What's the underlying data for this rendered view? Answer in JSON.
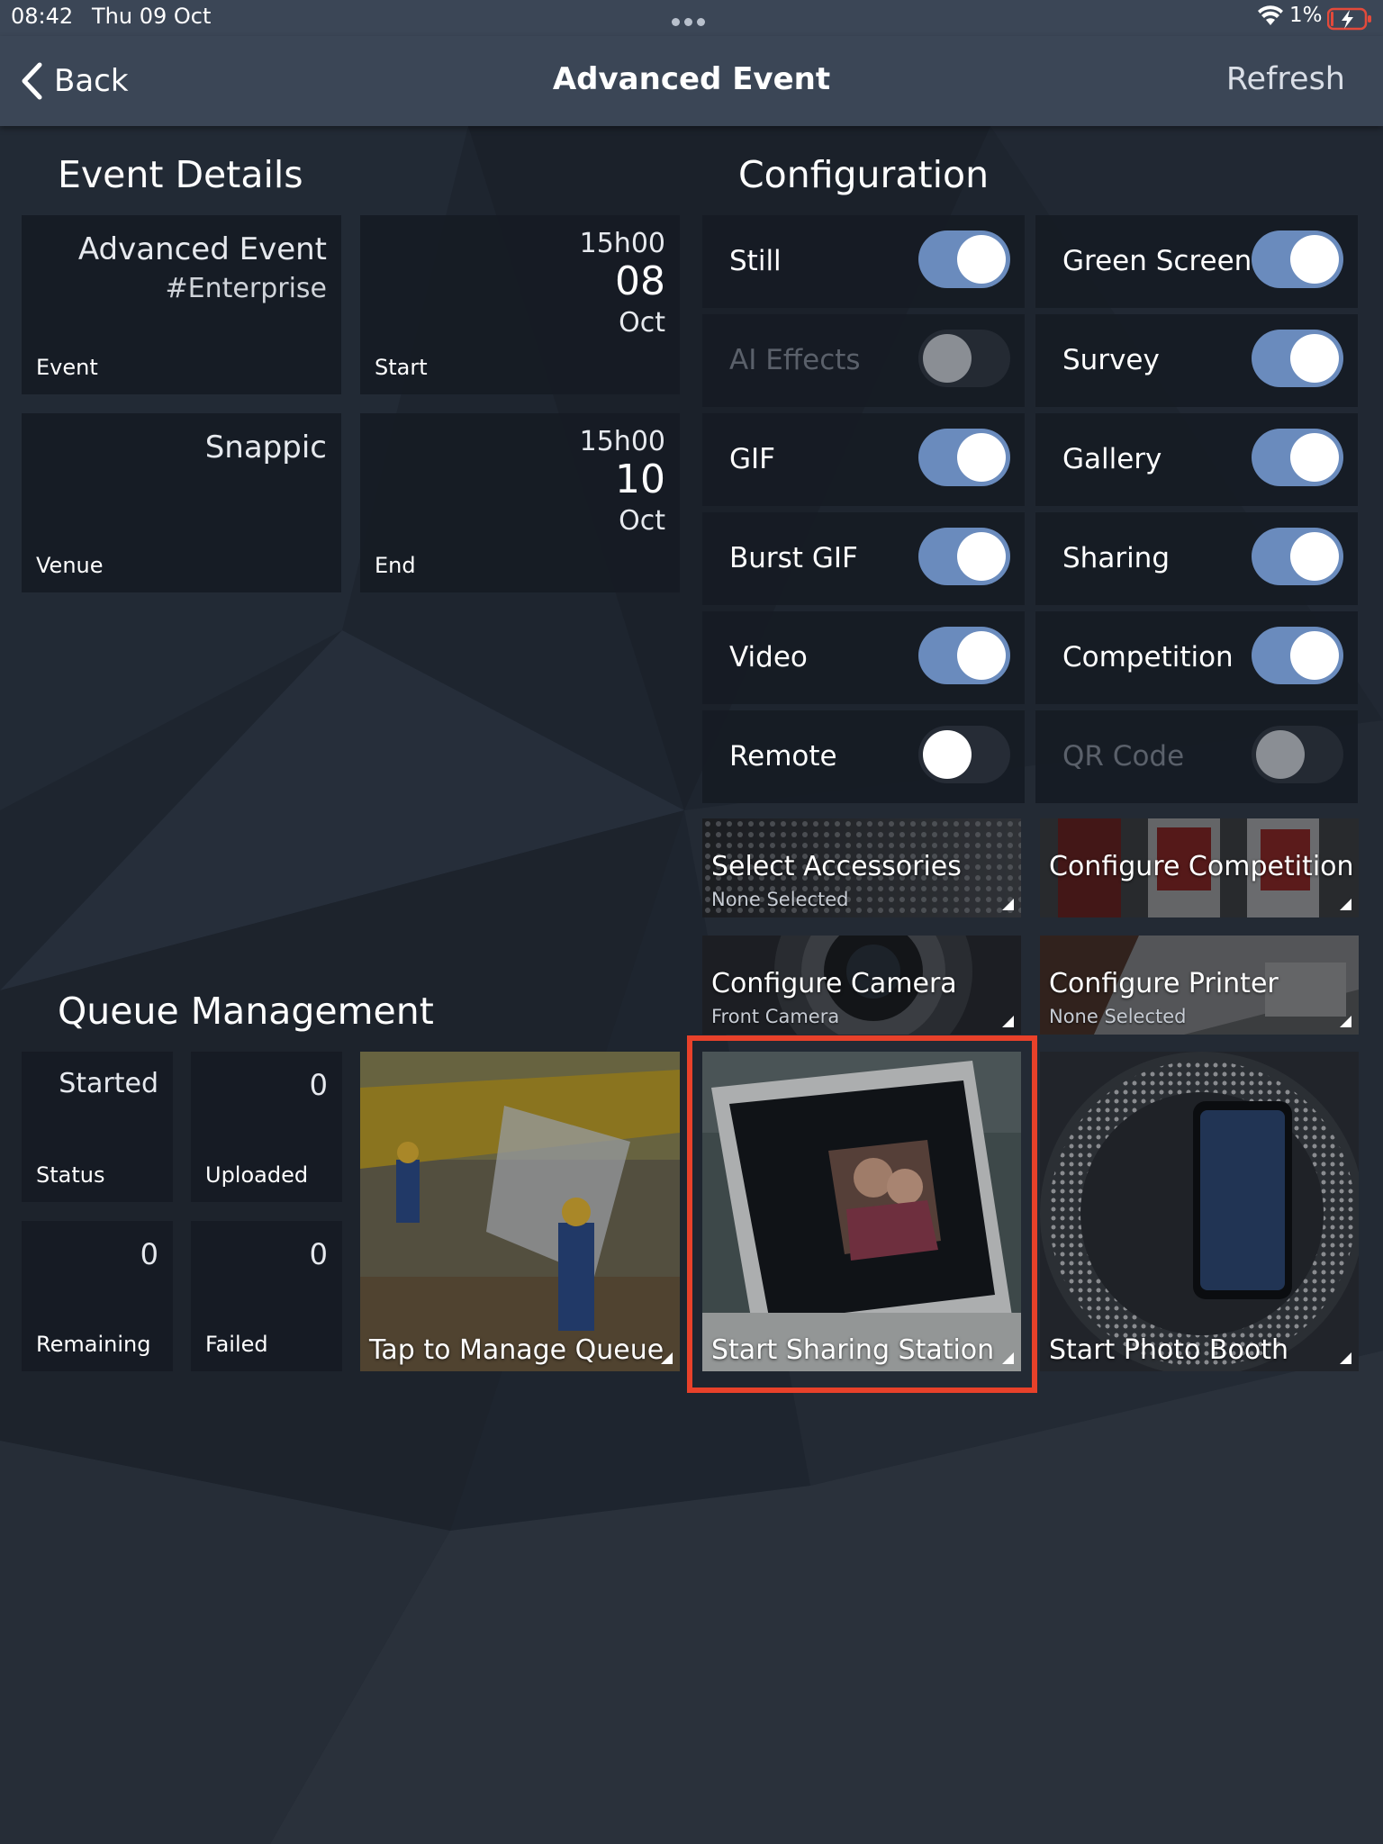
{
  "status_bar": {
    "time": "08:42",
    "date": "Thu 09 Oct",
    "battery": "1%"
  },
  "nav": {
    "back_label": "Back",
    "title": "Advanced Event",
    "refresh_label": "Refresh"
  },
  "event_details": {
    "heading": "Event Details",
    "event": {
      "name": "Advanced Event",
      "tag": "#Enterprise",
      "label": "Event"
    },
    "start": {
      "time": "15h00",
      "day": "08",
      "month": "Oct",
      "label": "Start"
    },
    "venue": {
      "name": "Snappic",
      "label": "Venue"
    },
    "end": {
      "time": "15h00",
      "day": "10",
      "month": "Oct",
      "label": "End"
    }
  },
  "configuration": {
    "heading": "Configuration",
    "toggles": [
      {
        "label": "Still",
        "state": "on"
      },
      {
        "label": "Green Screen",
        "state": "on"
      },
      {
        "label": "AI Effects",
        "state": "disabled"
      },
      {
        "label": "Survey",
        "state": "on"
      },
      {
        "label": "GIF",
        "state": "on"
      },
      {
        "label": "Gallery",
        "state": "on"
      },
      {
        "label": "Burst GIF",
        "state": "on"
      },
      {
        "label": "Sharing",
        "state": "on"
      },
      {
        "label": "Video",
        "state": "on"
      },
      {
        "label": "Competition",
        "state": "on"
      },
      {
        "label": "Remote",
        "state": "off"
      },
      {
        "label": "QR Code",
        "state": "disabled"
      }
    ],
    "select_accessories": {
      "title": "Select Accessories",
      "subtitle": "None Selected"
    },
    "configure_competition": {
      "title": "Configure Competition"
    },
    "configure_camera": {
      "title": "Configure Camera",
      "subtitle": "Front Camera"
    },
    "configure_printer": {
      "title": "Configure Printer",
      "subtitle": "None Selected"
    }
  },
  "queue_management": {
    "heading": "Queue Management",
    "status": {
      "value": "Started",
      "label": "Status"
    },
    "uploaded": {
      "value": "0",
      "label": "Uploaded"
    },
    "remaining": {
      "value": "0",
      "label": "Remaining"
    },
    "failed": {
      "value": "0",
      "label": "Failed"
    },
    "manage_queue": {
      "title": "Tap to Manage Queue"
    }
  },
  "actions": {
    "sharing_station": {
      "title": "Start Sharing Station"
    },
    "photo_booth": {
      "title": "Start Photo Booth"
    }
  },
  "colors": {
    "nav_bg": "#3b4656",
    "toggle_on": "#6a8bbd",
    "highlight": "#e8412a",
    "tile_bg": "#161b24"
  }
}
